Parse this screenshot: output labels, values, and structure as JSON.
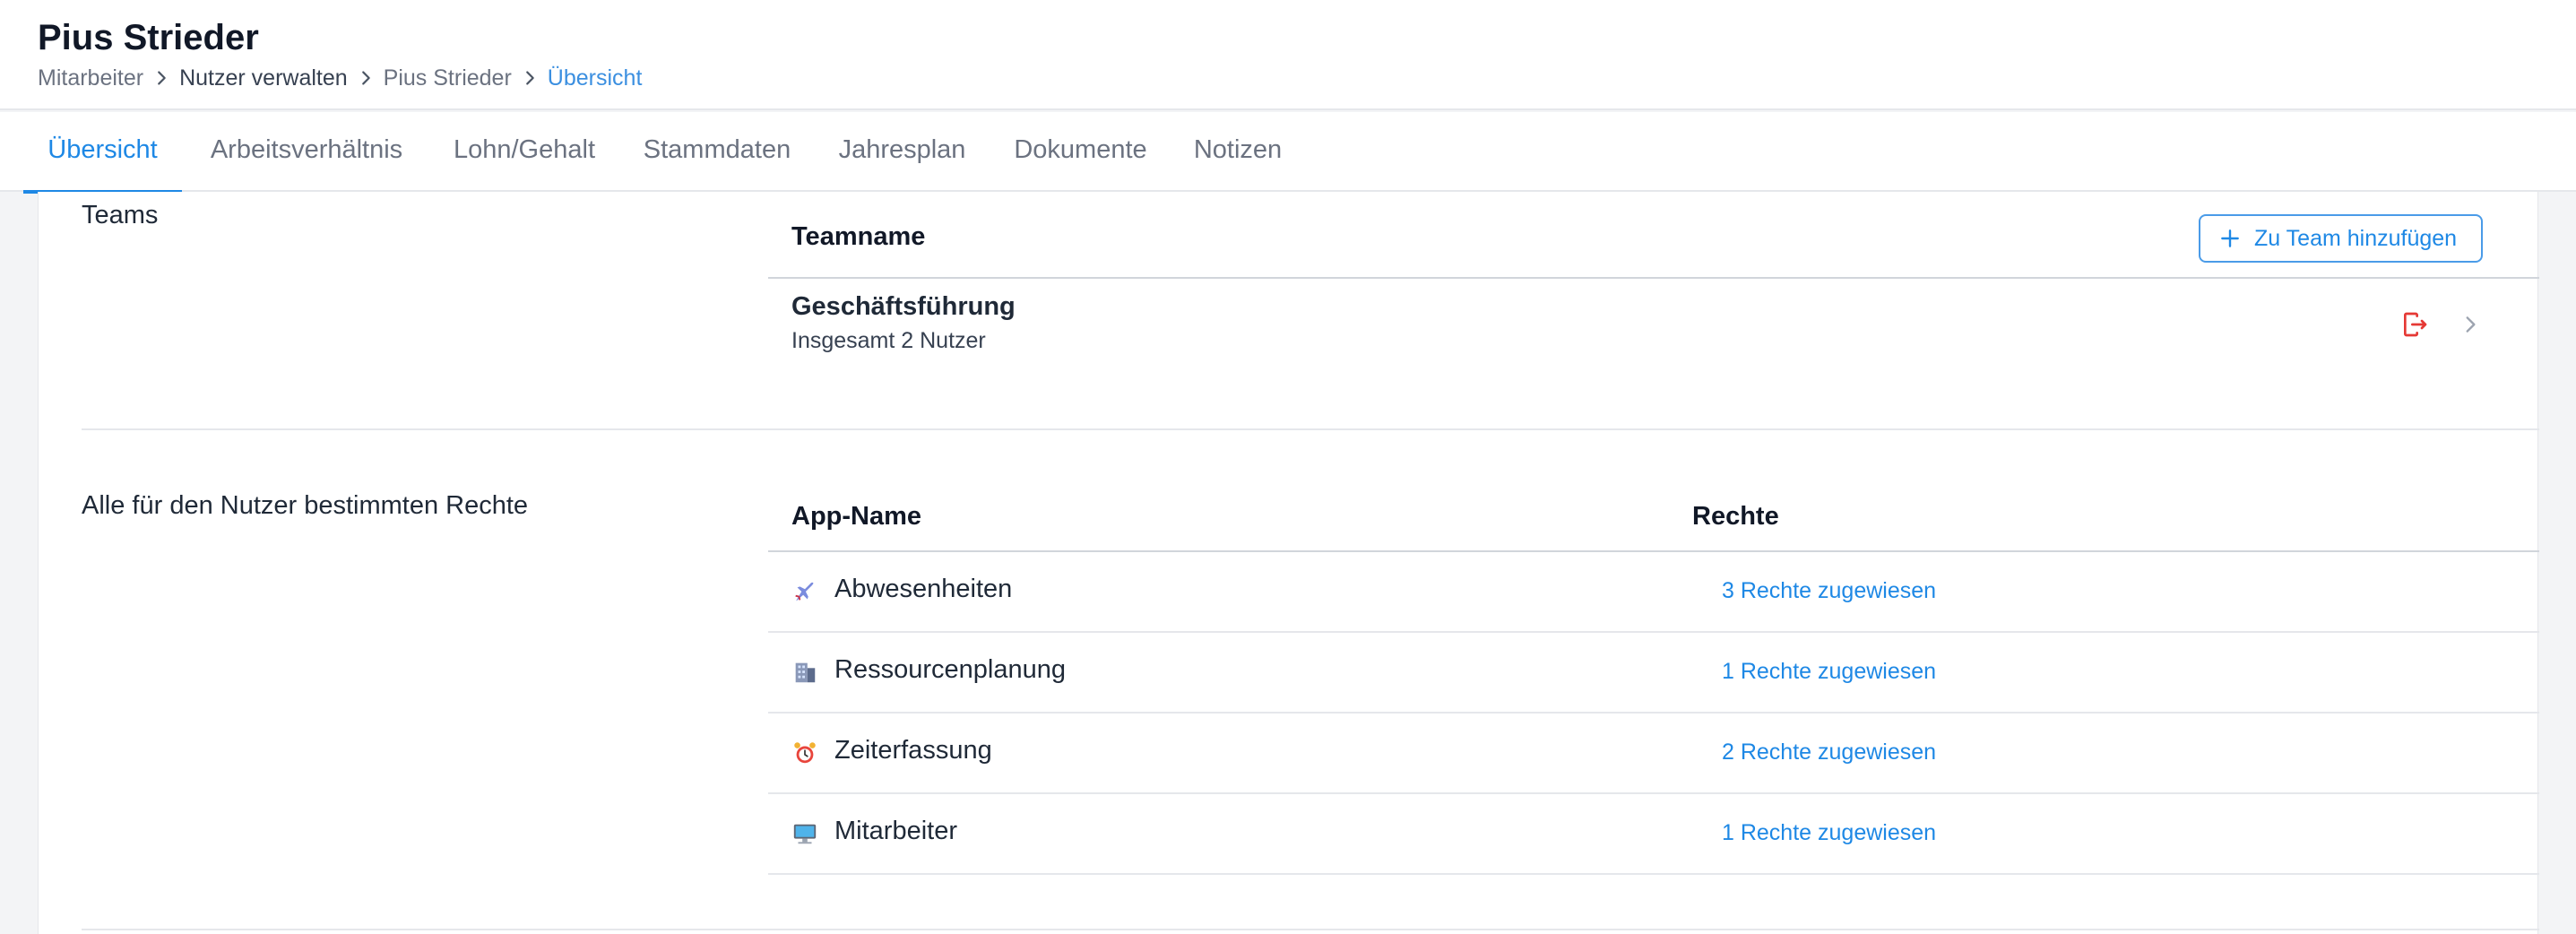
{
  "header": {
    "title": "Pius Strieder",
    "breadcrumb": [
      "Mitarbeiter",
      "Nutzer verwalten",
      "Pius Strieder",
      "Übersicht"
    ]
  },
  "tabs": [
    "Übersicht",
    "Arbeitsverhältnis",
    "Lohn/Gehalt",
    "Stammdaten",
    "Jahresplan",
    "Dokumente",
    "Notizen"
  ],
  "active_tab": "Übersicht",
  "teams_section": {
    "label": "Teams",
    "column_header": "Teamname",
    "add_button_label": "Zu Team hinzufügen",
    "teams": [
      {
        "name": "Geschäftsführung",
        "subtitle": "Insgesamt 2 Nutzer"
      }
    ]
  },
  "rights_section": {
    "label": "Alle für den Nutzer bestimmten Rechte",
    "col_app": "App-Name",
    "col_rights": "Rechte",
    "apps": [
      {
        "name": "Abwesenheiten",
        "icon": "airplane-icon",
        "rights": "3 Rechte zugewiesen"
      },
      {
        "name": "Ressourcenplanung",
        "icon": "building-icon",
        "rights": "1 Rechte zugewiesen"
      },
      {
        "name": "Zeiterfassung",
        "icon": "alarm-clock-icon",
        "rights": "2 Rechte zugewiesen"
      },
      {
        "name": "Mitarbeiter",
        "icon": "computer-icon",
        "rights": "1 Rechte zugewiesen"
      }
    ]
  },
  "colors": {
    "accent": "#1e88e5",
    "danger": "#e53935",
    "text": "#1f2937",
    "muted": "#6b7280"
  }
}
